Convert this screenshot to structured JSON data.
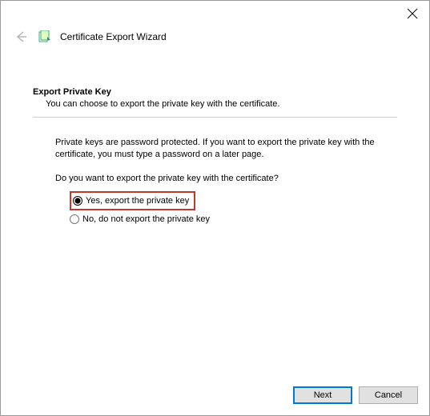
{
  "titlebar": {
    "close_aria": "Close"
  },
  "header": {
    "back_aria": "Back",
    "wizard_title": "Certificate Export Wizard"
  },
  "content": {
    "heading": "Export Private Key",
    "subtext": "You can choose to export the private key with the certificate.",
    "body": "Private keys are password protected. If you want to export the private key with the certificate, you must type a password on a later page.",
    "question": "Do you want to export the private key with the certificate?",
    "option_yes": "Yes, export the private key",
    "option_no": "No, do not export the private key",
    "selected": "yes"
  },
  "footer": {
    "next_label": "Next",
    "cancel_label": "Cancel"
  }
}
